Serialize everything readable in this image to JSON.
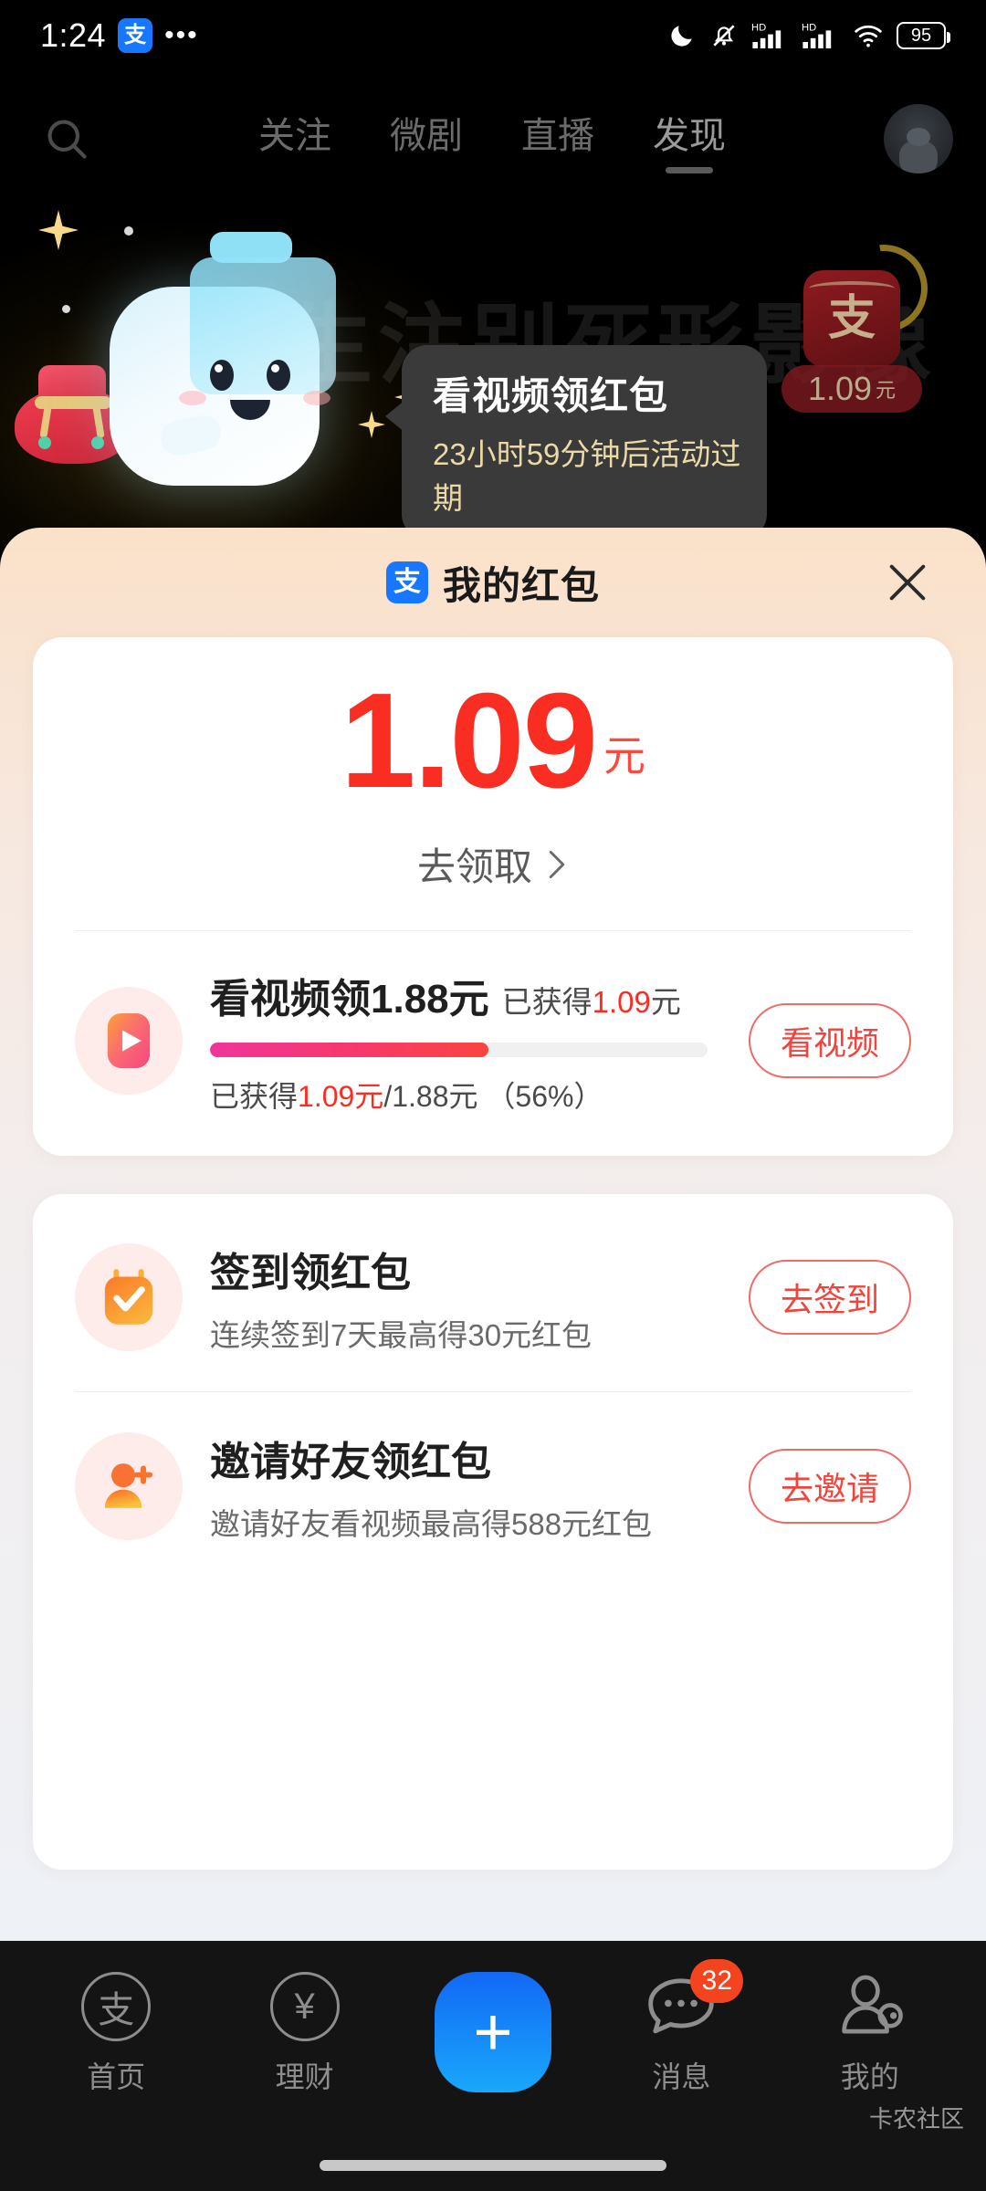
{
  "status_bar": {
    "time": "1:24",
    "app_badge": "支",
    "more": "•••",
    "icons": [
      "moon-dnd-icon",
      "bell-muted-icon",
      "hd-signal-icon",
      "hd-signal-icon",
      "wifi-icon"
    ],
    "battery_level": "95"
  },
  "top_nav": {
    "search_icon": "search-icon",
    "tabs": [
      {
        "label": "关注",
        "active": false
      },
      {
        "label": "微剧",
        "active": false
      },
      {
        "label": "直播",
        "active": false
      },
      {
        "label": "发现",
        "active": true
      }
    ],
    "avatar": "user-avatar"
  },
  "hero": {
    "watermark": "一生注别死形影像",
    "red_packet": {
      "logo": "支",
      "amount": "1.09",
      "unit": "元"
    },
    "tooltip": {
      "title": "看视频领红包",
      "subtitle": "23小时59分钟后活动过期"
    }
  },
  "sheet": {
    "logo": "支",
    "title": "我的红包",
    "close_icon": "close-icon",
    "balance": {
      "amount": "1.09",
      "unit": "元",
      "claim_label": "去领取",
      "claim_chevron": "chevron-right-icon"
    },
    "video_task": {
      "icon": "play-video-icon",
      "title": "看视频领1.88元",
      "earned_prefix": "已获得",
      "earned_value": "1.09",
      "earned_unit": "元",
      "progress_percent": 56,
      "progress_text_prefix": "已获得",
      "progress_earned": "1.09元",
      "progress_total": "/1.88元",
      "progress_pct_text": "（56%）",
      "button": "看视频",
      "bar_color_start": "#f0359b",
      "bar_color_end": "#f9453f"
    },
    "tasks": [
      {
        "icon": "calendar-check-icon",
        "title": "签到领红包",
        "subtitle": "连续签到7天最高得30元红包",
        "button": "去签到"
      },
      {
        "icon": "invite-friend-icon",
        "title": "邀请好友领红包",
        "subtitle": "邀请好友看视频最高得588元红包",
        "button": "去邀请"
      }
    ]
  },
  "bottom_nav": {
    "items": [
      {
        "label": "首页",
        "icon": "alipay-home-icon",
        "glyph": "支",
        "badge": null,
        "dot": false
      },
      {
        "label": "理财",
        "icon": "yuan-finance-icon",
        "glyph": "¥",
        "badge": null,
        "dot": true
      },
      {
        "label": "",
        "icon": "add-plus-button",
        "glyph": "+",
        "badge": null,
        "dot": false
      },
      {
        "label": "消息",
        "icon": "chat-bubble-icon",
        "glyph": "",
        "badge": "32",
        "dot": false
      },
      {
        "label": "我的",
        "icon": "profile-person-icon",
        "glyph": "",
        "badge": null,
        "dot": false
      }
    ]
  },
  "watermark_bottom": "卡农社区",
  "colors": {
    "accent_red": "#fa2d23",
    "alipay_blue": "#1777ff",
    "badge_red": "#f4431f"
  }
}
